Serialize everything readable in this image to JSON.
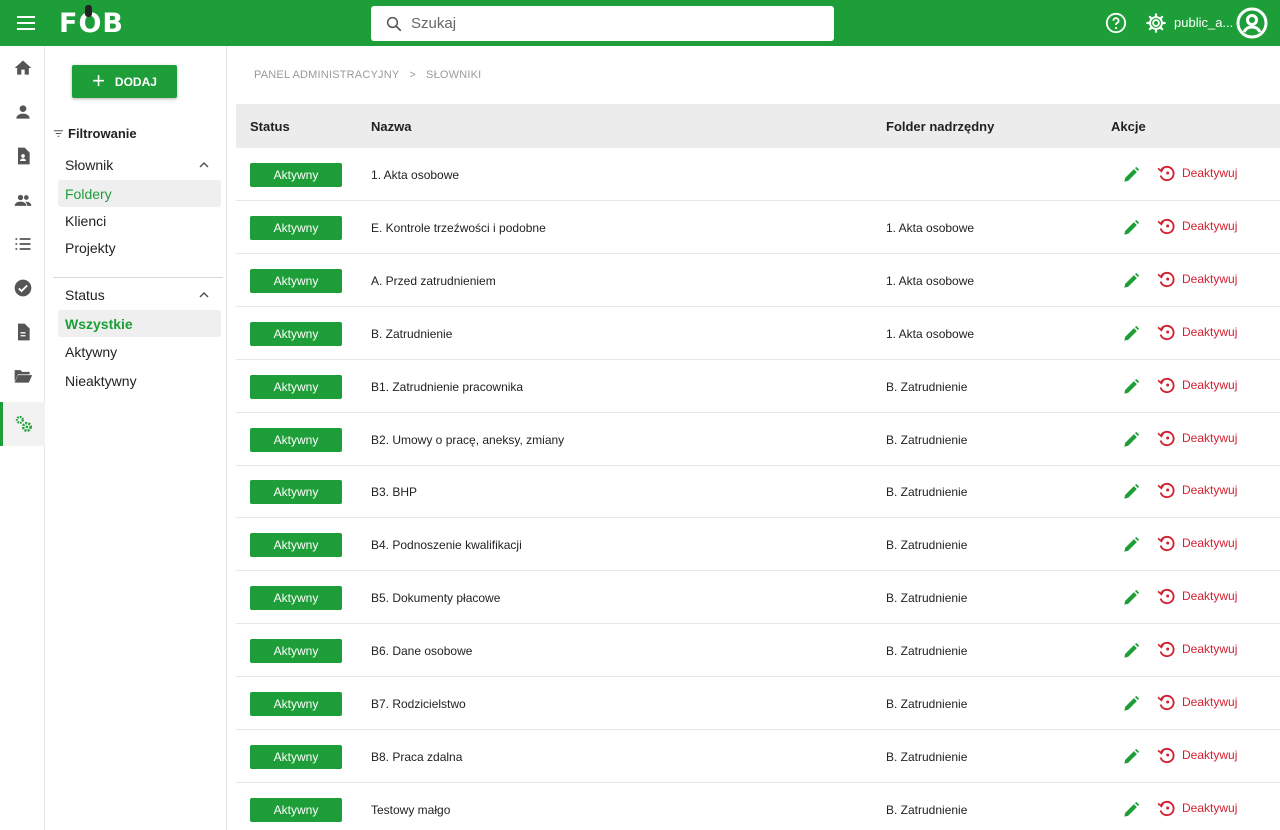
{
  "header": {
    "logo": "FOB",
    "search_placeholder": "Szukaj",
    "username": "public_a..."
  },
  "colors": {
    "brand": "#1e9e38",
    "danger": "#d32030"
  },
  "rail": [
    {
      "icon": "home-icon"
    },
    {
      "icon": "person-icon"
    },
    {
      "icon": "document-person-icon"
    },
    {
      "icon": "people-icon"
    },
    {
      "icon": "list-icon"
    },
    {
      "icon": "check-circle-icon"
    },
    {
      "icon": "document-icon"
    },
    {
      "icon": "folder-open-icon"
    },
    {
      "icon": "settings-cogs-icon",
      "active": true
    }
  ],
  "filters": {
    "add_label": "DODAJ",
    "title": "Filtrowanie",
    "dictionary_group": "Słownik",
    "dictionary_items": [
      "Foldery",
      "Klienci",
      "Projekty"
    ],
    "status_group": "Status",
    "status_items": [
      "Wszystkie",
      "Aktywny",
      "Nieaktywny"
    ]
  },
  "breadcrumb": [
    "PANEL ADMINISTRACYJNY",
    ">",
    "SŁOWNIKI"
  ],
  "table": {
    "columns": [
      "Status",
      "Nazwa",
      "Folder nadrzędny",
      "Akcje"
    ],
    "deactivate_label": "Deaktywuj",
    "rows": [
      {
        "status": "Aktywny",
        "name": "1. Akta osobowe",
        "parent": ""
      },
      {
        "status": "Aktywny",
        "name": "E. Kontrole trzeźwości i podobne",
        "parent": "1. Akta osobowe"
      },
      {
        "status": "Aktywny",
        "name": "A. Przed zatrudnieniem",
        "parent": "1. Akta osobowe"
      },
      {
        "status": "Aktywny",
        "name": "B. Zatrudnienie",
        "parent": "1. Akta osobowe"
      },
      {
        "status": "Aktywny",
        "name": "B1. Zatrudnienie pracownika",
        "parent": "B. Zatrudnienie"
      },
      {
        "status": "Aktywny",
        "name": "B2. Umowy o pracę, aneksy, zmiany",
        "parent": "B. Zatrudnienie"
      },
      {
        "status": "Aktywny",
        "name": "B3. BHP",
        "parent": "B. Zatrudnienie"
      },
      {
        "status": "Aktywny",
        "name": "B4. Podnoszenie kwalifikacji",
        "parent": "B. Zatrudnienie"
      },
      {
        "status": "Aktywny",
        "name": "B5. Dokumenty płacowe",
        "parent": "B. Zatrudnienie"
      },
      {
        "status": "Aktywny",
        "name": "B6. Dane osobowe",
        "parent": "B. Zatrudnienie"
      },
      {
        "status": "Aktywny",
        "name": "B7. Rodzicielstwo",
        "parent": "B. Zatrudnienie"
      },
      {
        "status": "Aktywny",
        "name": "B8. Praca zdalna",
        "parent": "B. Zatrudnienie"
      },
      {
        "status": "Aktywny",
        "name": "Testowy małgo",
        "parent": "B. Zatrudnienie"
      }
    ]
  }
}
